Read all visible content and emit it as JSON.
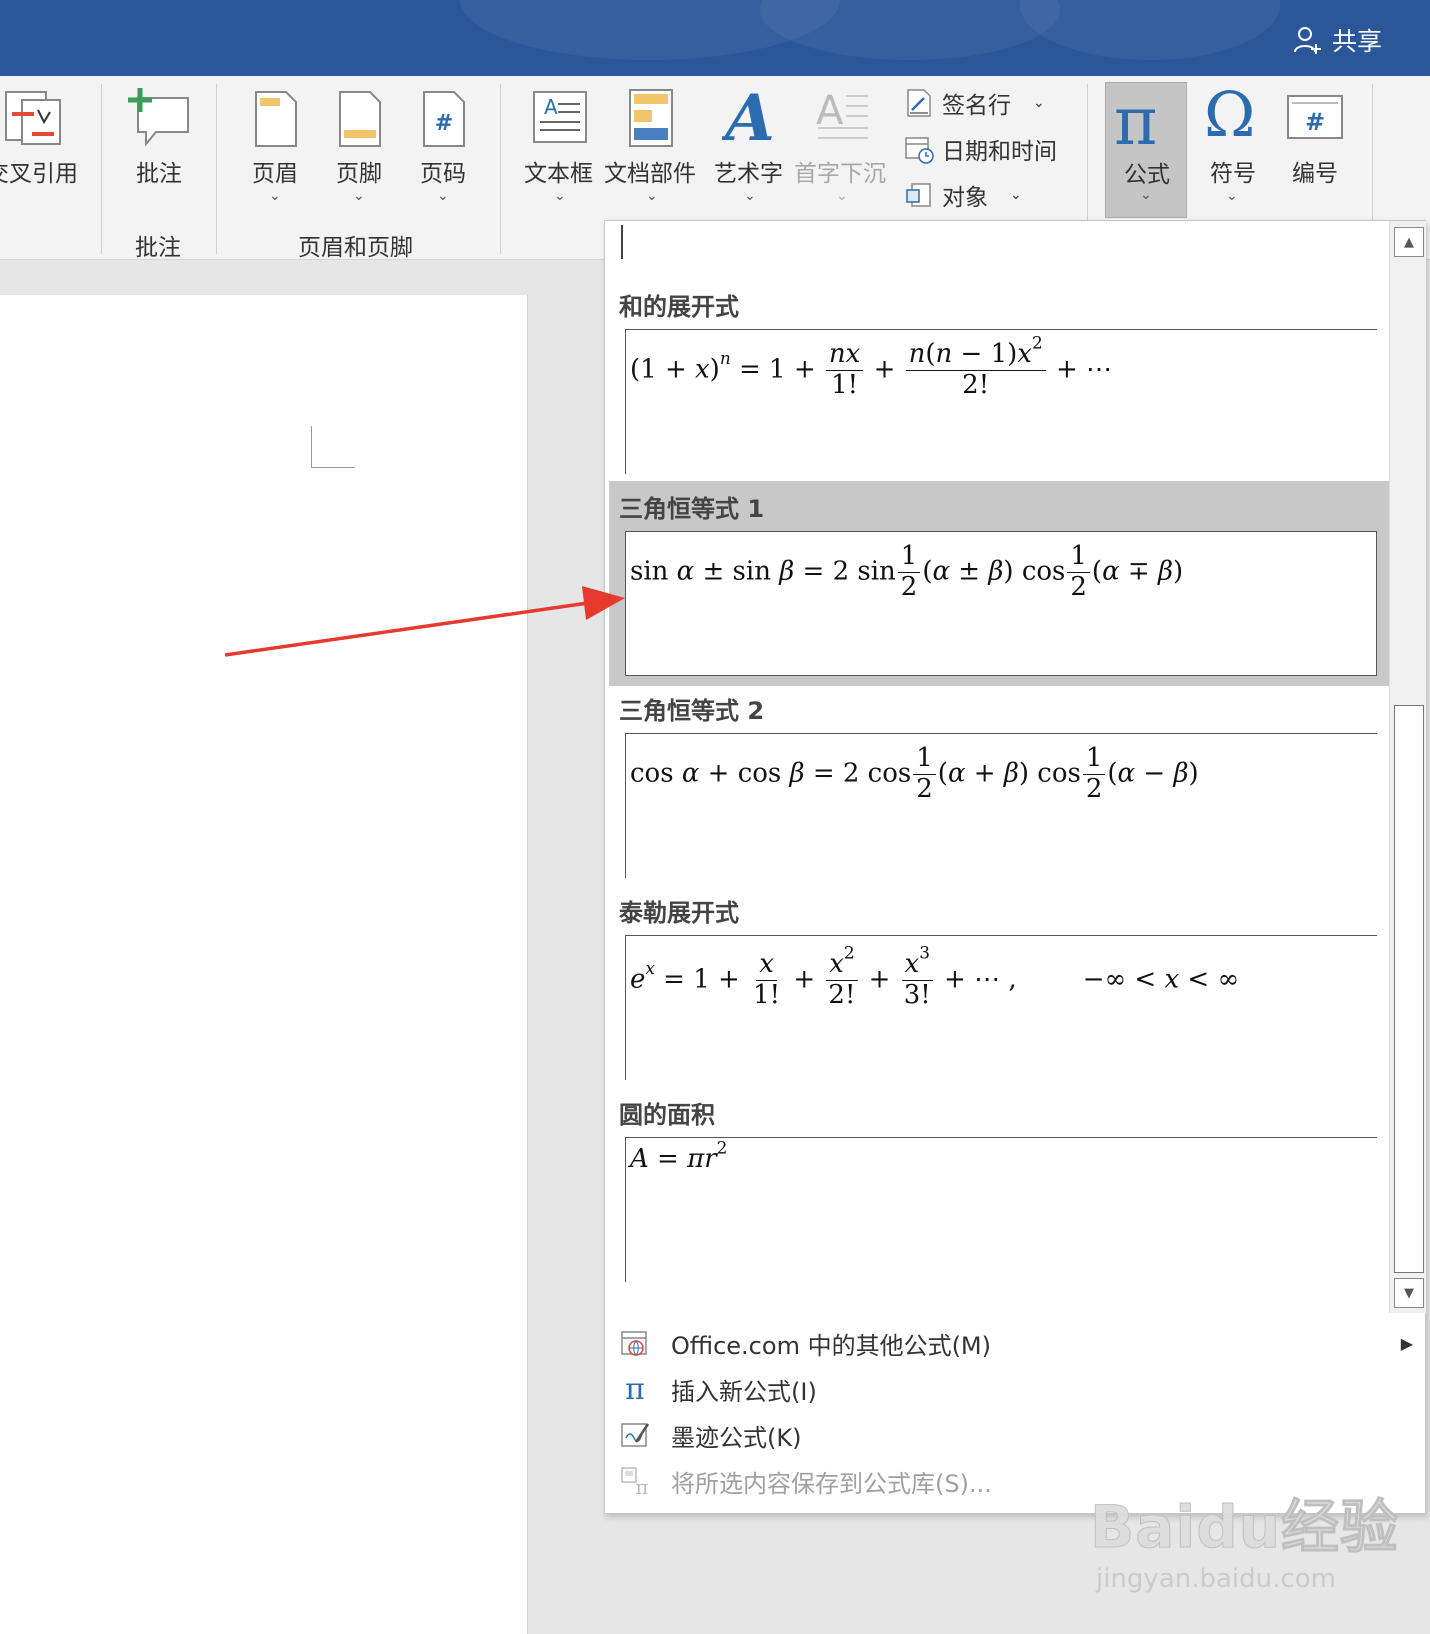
{
  "titlebar": {
    "share_label": "共享"
  },
  "ribbon": {
    "cross_reference": "交叉引用",
    "comment": "批注",
    "comment_group": "批注",
    "header": "页眉",
    "footer": "页脚",
    "page_number": "页码",
    "header_footer_group": "页眉和页脚",
    "textbox": "文本框",
    "quick_parts": "文档部件",
    "wordart": "艺术字",
    "dropcap": "首字下沉",
    "signature_line": "签名行",
    "date_time": "日期和时间",
    "object": "对象",
    "equation": "公式",
    "symbol": "符号",
    "number": "编号"
  },
  "gallery": {
    "items": [
      {
        "title": "和的展开式"
      },
      {
        "title": "三角恒等式 1"
      },
      {
        "title": "三角恒等式 2"
      },
      {
        "title": "泰勒展开式"
      },
      {
        "title": "圆的面积"
      }
    ]
  },
  "menu": {
    "office_more": "Office.com 中的其他公式(M)",
    "insert_new": "插入新公式(I)",
    "ink_equation": "墨迹公式(K)",
    "save_selection": "将所选内容保存到公式库(S)..."
  },
  "watermark": {
    "brand": "Baidu经验",
    "url": "jingyan.baidu.com"
  },
  "colors": {
    "title_bar": "#2b579a",
    "arrow": "#e8392f",
    "selected": "#c8c8c8"
  }
}
